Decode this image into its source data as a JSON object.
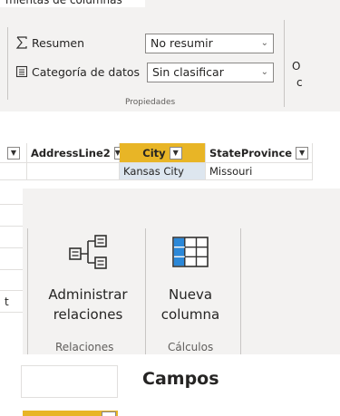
{
  "ribbon": {
    "tab_title": "mientas de columnas",
    "properties": {
      "summary_label": "Resumen",
      "summary_value": "No resumir",
      "category_label": "Categoría de datos",
      "category_value": "Sin clasificar",
      "group_label": "Propiedades"
    },
    "cut_right_1": "O",
    "cut_right_2": "c"
  },
  "grid": {
    "columns": [
      {
        "label": "AddressLine2"
      },
      {
        "label": "City"
      },
      {
        "label": "StateProvince"
      }
    ],
    "row1": {
      "city": "Kansas City",
      "state": "Missouri"
    },
    "cut_row_text": "t"
  },
  "zoom_ribbon": {
    "manage_relations_line1": "Administrar",
    "manage_relations_line2": "relaciones",
    "relations_group_label": "Relaciones",
    "new_column_line1": "Nueva",
    "new_column_line2": "columna",
    "calculations_group_label": "Cálculos"
  },
  "fields_pane": {
    "title": "Campos"
  },
  "colors": {
    "selected_header": "#e8b526",
    "selected_cell": "#dde6ef",
    "ribbon_bg": "#f3f2f1",
    "table_icon_blue": "#2b88d8"
  },
  "icons": [
    "sigma-icon",
    "data-category-icon",
    "chevron-down-icon",
    "manage-relationships-icon",
    "new-column-icon"
  ]
}
